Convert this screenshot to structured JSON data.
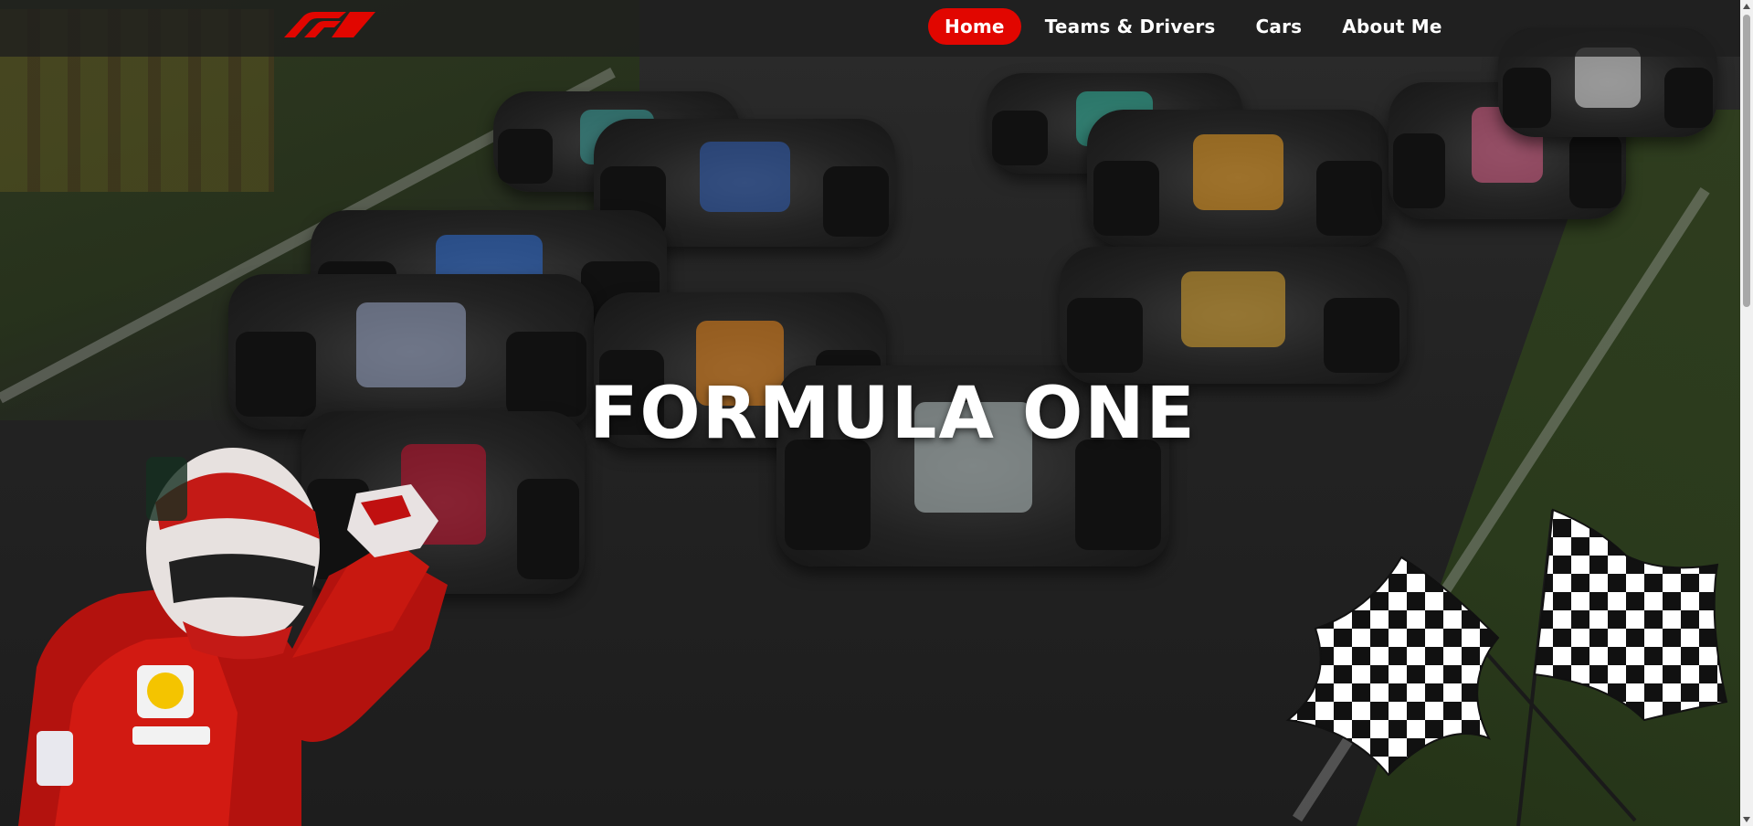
{
  "page": {
    "title": "Formula One"
  },
  "brand": {
    "logo_name": "F1",
    "accent_color": "#e10600"
  },
  "nav": {
    "items": [
      {
        "label": "Home",
        "active": true
      },
      {
        "label": "Teams & Drivers",
        "active": false
      },
      {
        "label": "Cars",
        "active": false
      },
      {
        "label": "About Me",
        "active": false
      }
    ]
  },
  "hero": {
    "title": "FORMULA ONE"
  },
  "icons": {
    "logo": "f1-logo-icon",
    "driver": "driver-illustration",
    "flags": "checkered-flags-icon"
  }
}
